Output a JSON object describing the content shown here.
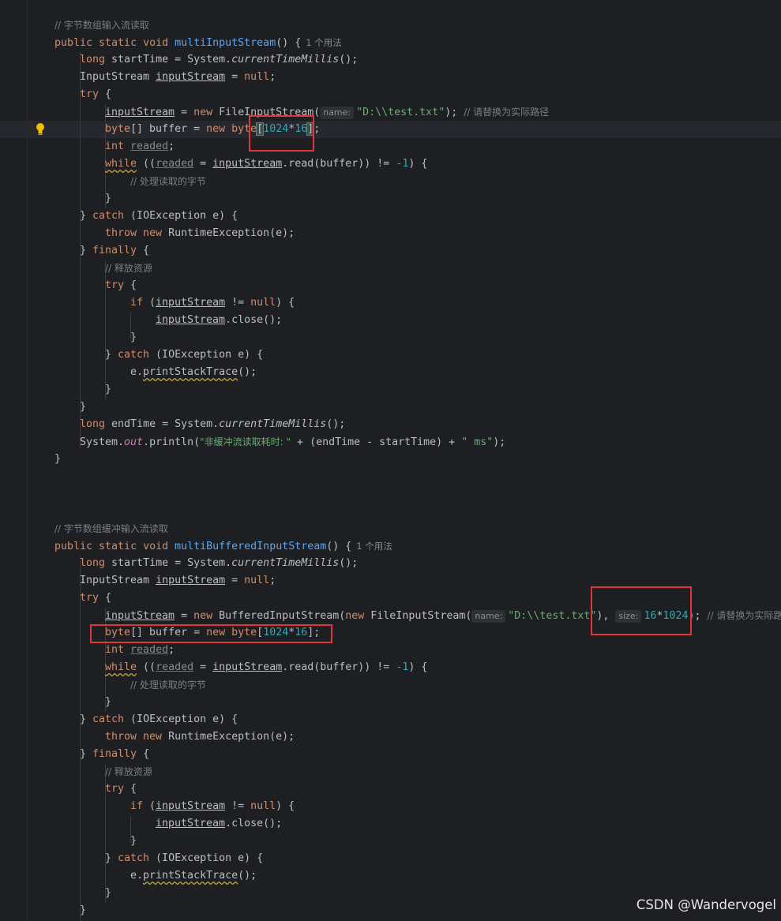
{
  "editor": {
    "method1": {
      "comment": "// 字节数组输入流读取",
      "decl_prefix": "public static void ",
      "name": "multiInputStream",
      "decl_suffix": "() {",
      "usages": "1 个用法",
      "l_long": "long",
      "l_start_rest": " startTime = System.",
      "l_ctm": "currentTimeMillis",
      "l_end_paren": "();",
      "l_is_type": "InputStream ",
      "l_is_var": "inputStream",
      "l_is_eq": " = ",
      "l_null": "null",
      "l_semi": ";",
      "l_try": "try",
      "l_brace_open": " {",
      "l_assign": " = ",
      "l_new": "new",
      "l_fis": " FileInputStream(",
      "hint_name": "name:",
      "l_path": "\"D:\\\\test.txt\"",
      "l_after_path": "); ",
      "l_path_cmt": "// 请替换为实际路径",
      "l_byte": "byte",
      "l_buf_mid": "[] buffer = ",
      "l_byte2": " byte",
      "l_lb": "[",
      "l_1024": "1024",
      "l_star": "*",
      "l_16": "16",
      "l_rb": "]",
      "l_int": "int",
      "l_readed": "readed",
      "l_while": "while",
      "l_while_mid": " ((",
      "l_read": ".read(buffer)) != ",
      "l_minus1": "-1",
      "l_while_end": ") {",
      "l_proc_cmt": "// 处理读取的字节",
      "l_close_brace": "}",
      "l_catch_open": "} ",
      "l_catch": "catch",
      "l_catch_rest": " (IOException e) {",
      "l_throw": "throw",
      "l_rte": " RuntimeException(e);",
      "l_finally": "finally",
      "l_release_cmt": "// 释放资源",
      "l_if": "if",
      "l_if_mid": " (",
      "l_ne": " != ",
      "l_if_end": ") {",
      "l_close_call": ".close();",
      "l_e": "e.",
      "l_pst": "printStackTrace",
      "l_end_rest": " endTime = System.",
      "l_sys": "System.",
      "l_out": "out",
      "l_println": ".println(",
      "l_msg1": "\"非缓冲流读取耗时: \"",
      "l_concat": " + (endTime - startTime) + ",
      "l_ms": "\" ms\"",
      "l_println_end": ");"
    },
    "method2": {
      "comment": "// 字节数组缓冲输入流读取",
      "name": "multiBufferedInputStream",
      "bis": " BufferedInputStream(",
      "fis_in": " FileInputStream(",
      "path": "\"D:\\\\test.txt\"",
      "after_path": "), ",
      "hint_size": "size:",
      "size_16": "16",
      "size_1024": "1024",
      "after_size": "); ",
      "path_cmt": "// 请替换为实际路径",
      "usages": "1 个用法"
    }
  },
  "watermark": "CSDN @Wandervogel"
}
